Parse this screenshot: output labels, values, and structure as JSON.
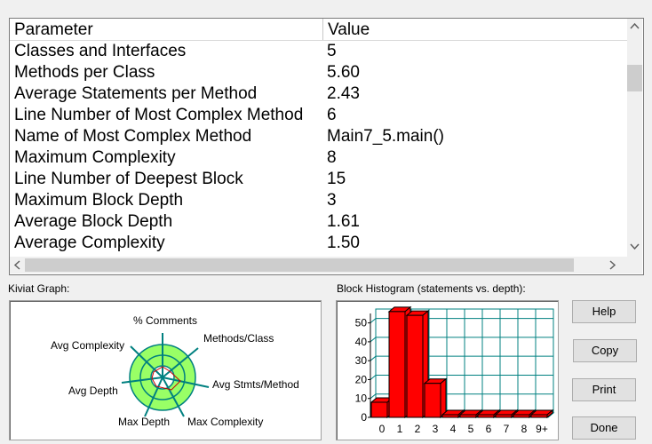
{
  "table": {
    "columns": [
      "Parameter",
      "Value"
    ],
    "rows": [
      {
        "param": "Classes and Interfaces",
        "value": "5"
      },
      {
        "param": "Methods per Class",
        "value": "5.60"
      },
      {
        "param": "Average Statements per Method",
        "value": "2.43"
      },
      {
        "param": "Line Number of Most Complex Method",
        "value": "6"
      },
      {
        "param": "Name of Most Complex Method",
        "value": "Main7_5.main()"
      },
      {
        "param": "Maximum Complexity",
        "value": "8"
      },
      {
        "param": "Line Number of Deepest Block",
        "value": "15"
      },
      {
        "param": "Maximum Block Depth",
        "value": "3"
      },
      {
        "param": "Average Block Depth",
        "value": "1.61"
      },
      {
        "param": "Average Complexity",
        "value": "1.50"
      }
    ],
    "scroll_up": "^",
    "scroll_down": "v",
    "scroll_left": "<",
    "scroll_right": ">"
  },
  "kiviat": {
    "label": "Kiviat Graph:",
    "axes": [
      "% Comments",
      "Methods/Class",
      "Avg Stmts/Method",
      "Max Complexity",
      "Max Depth",
      "Avg Depth",
      "Avg Complexity"
    ]
  },
  "histogram": {
    "label": "Block Histogram (statements vs. depth):",
    "y_ticks": [
      "50",
      "40",
      "30",
      "20",
      "10",
      "0"
    ],
    "x_ticks": [
      "0",
      "1",
      "2",
      "3",
      "4",
      "5",
      "6",
      "7",
      "8",
      "9+"
    ]
  },
  "buttons": {
    "help": "Help",
    "copy": "Copy",
    "print": "Print",
    "done": "Done"
  },
  "colors": {
    "bar": "#ff0000",
    "grid": "#008080",
    "kiviat_fill": "#99ff66"
  },
  "chart_data": {
    "type": "bar",
    "categories": [
      "0",
      "1",
      "2",
      "3",
      "4",
      "5",
      "6",
      "7",
      "8",
      "9+"
    ],
    "values": [
      8,
      56,
      54,
      18,
      0,
      0,
      0,
      0,
      0,
      0
    ],
    "ylim": [
      0,
      55
    ]
  }
}
